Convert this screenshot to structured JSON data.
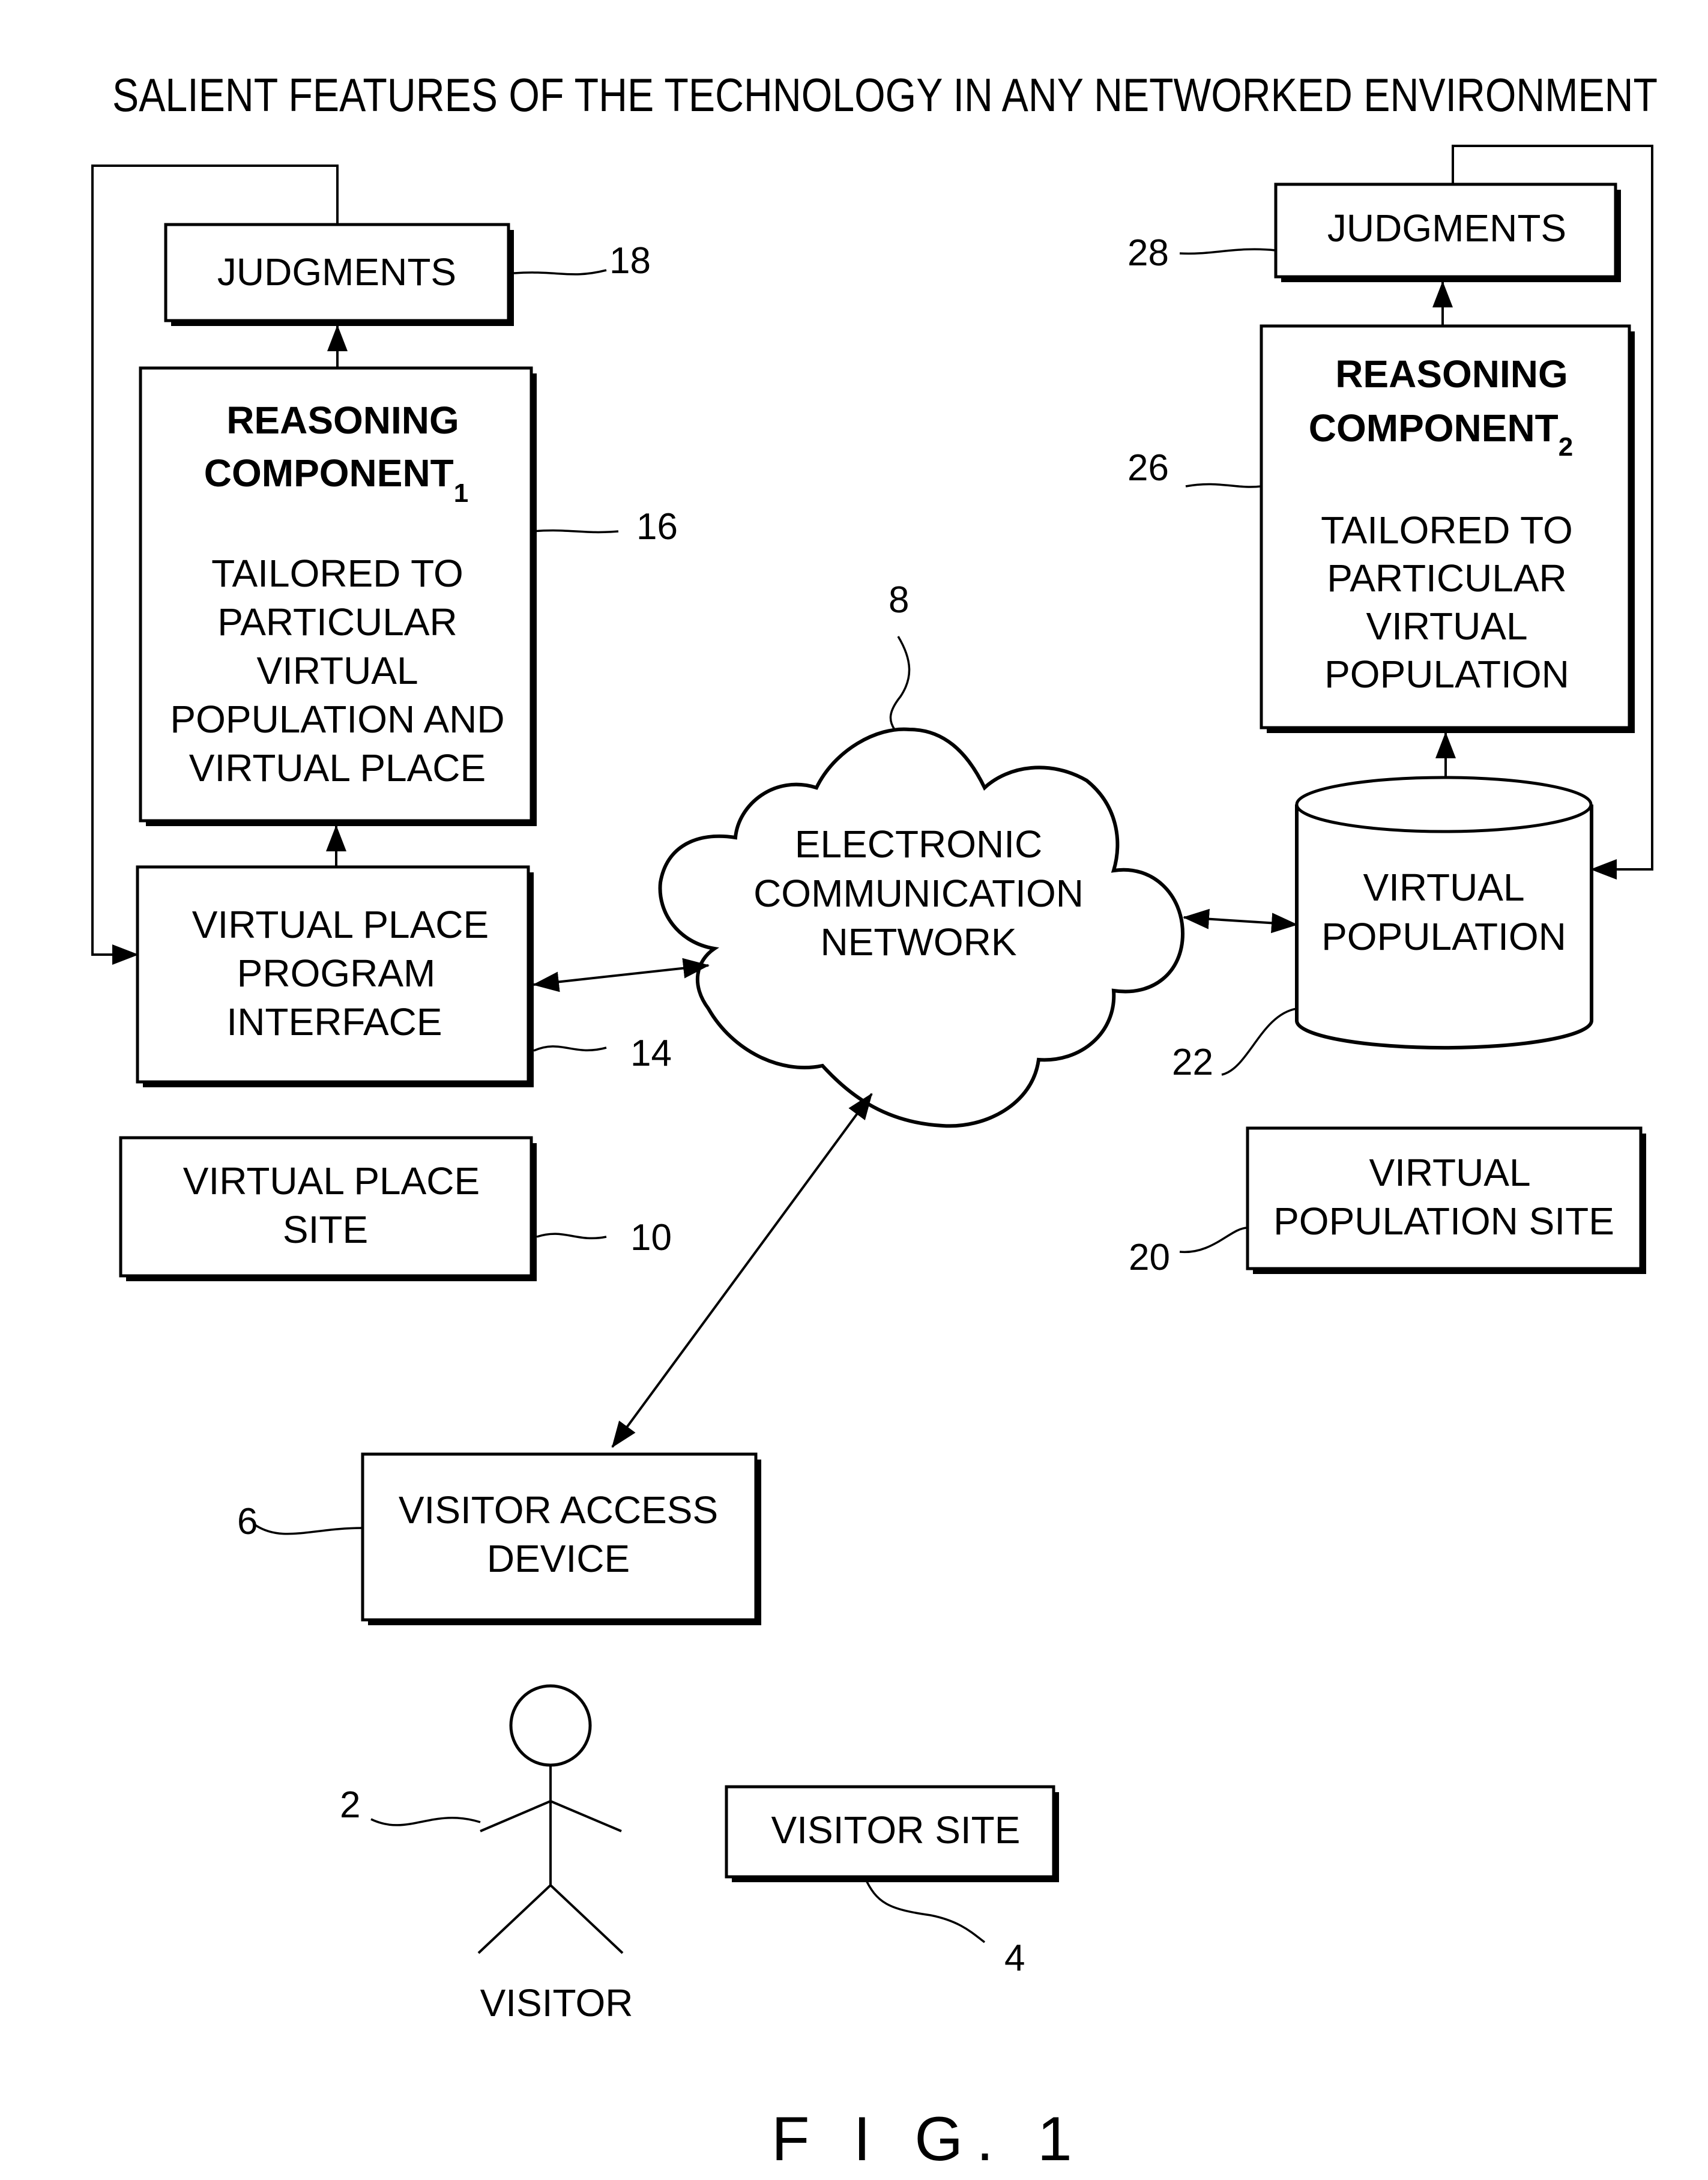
{
  "title": "SALIENT FEATURES OF THE TECHNOLOGY IN ANY NETWORKED ENVIRONMENT",
  "figure_label": "F I G. 1",
  "virtual_place_site": {
    "judgments": {
      "label": "JUDGMENTS",
      "ref": "18"
    },
    "reasoning_component": {
      "title_line1": "REASONING",
      "title_line2": "COMPONENT",
      "subscript": "1",
      "desc_lines": [
        "TAILORED TO",
        "PARTICULAR",
        "VIRTUAL",
        "POPULATION AND",
        "VIRTUAL PLACE"
      ],
      "ref": "16"
    },
    "program_interface": {
      "lines": [
        "VIRTUAL PLACE",
        "PROGRAM",
        "INTERFACE"
      ],
      "ref": "14"
    },
    "site": {
      "lines": [
        "VIRTUAL PLACE",
        "SITE"
      ],
      "ref": "10"
    }
  },
  "network": {
    "lines": [
      "ELECTRONIC",
      "COMMUNICATION",
      "NETWORK"
    ],
    "ref": "8"
  },
  "virtual_population_site": {
    "judgments": {
      "label": "JUDGMENTS",
      "ref": "28"
    },
    "reasoning_component": {
      "title_line1": "REASONING",
      "title_line2": "COMPONENT",
      "subscript": "2",
      "desc_lines": [
        "TAILORED TO",
        "PARTICULAR",
        "VIRTUAL",
        "POPULATION"
      ],
      "ref": "26"
    },
    "database": {
      "lines": [
        "VIRTUAL",
        "POPULATION"
      ],
      "ref": "22"
    },
    "site": {
      "lines": [
        "VIRTUAL",
        "POPULATION SITE"
      ],
      "ref": "20"
    }
  },
  "visitor_side": {
    "access_device": {
      "lines": [
        "VISITOR ACCESS",
        "DEVICE"
      ],
      "ref": "6"
    },
    "visitor": {
      "label": "VISITOR",
      "ref": "2"
    },
    "site": {
      "label": "VISITOR SITE",
      "ref": "4"
    }
  }
}
